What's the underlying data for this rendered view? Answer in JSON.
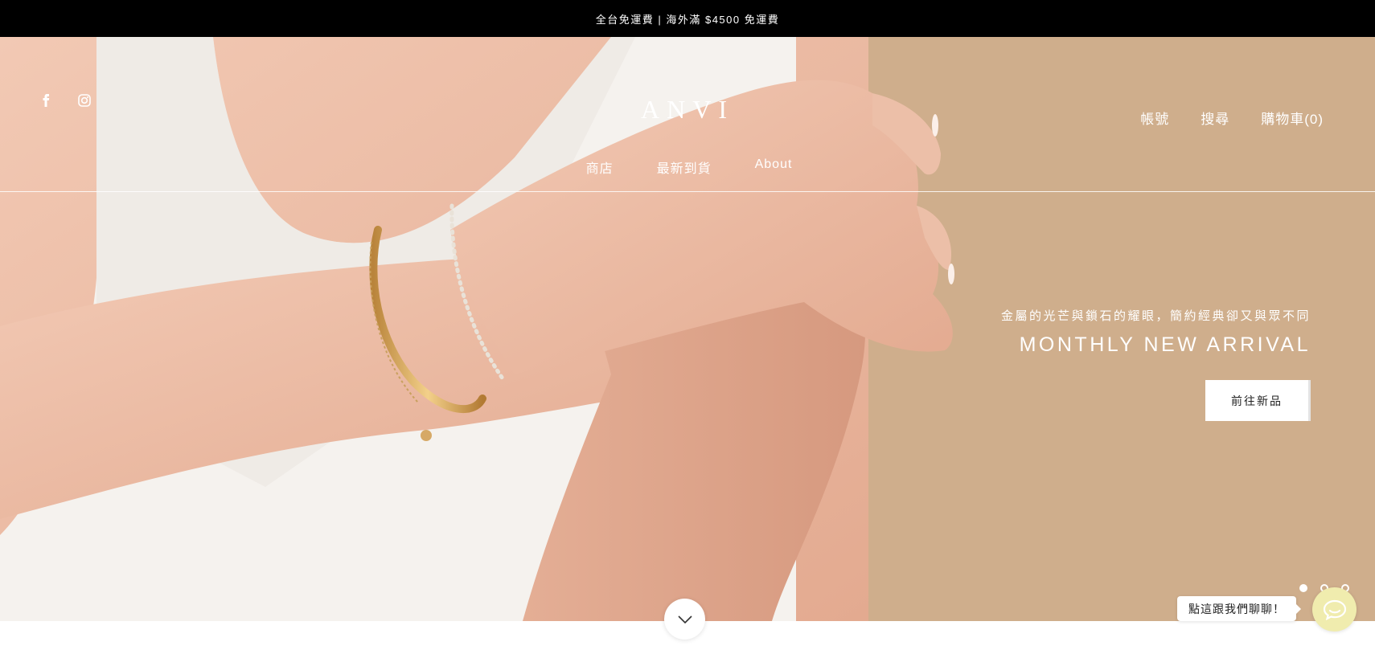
{
  "announcement": {
    "text": "全台免運費 | 海外滿 $4500 免運費"
  },
  "header": {
    "logo": "ANVI",
    "social": [
      {
        "name": "facebook-icon"
      },
      {
        "name": "instagram-icon"
      }
    ],
    "right_nav": [
      {
        "label": "帳號"
      },
      {
        "label": "搜尋"
      },
      {
        "label": "購物車(0)"
      }
    ],
    "main_nav": [
      {
        "label": "商店"
      },
      {
        "label": "最新到貨"
      },
      {
        "label": "About"
      }
    ]
  },
  "hero": {
    "subtitle": "金屬的光芒與鎖石的耀眼，簡約經典卻又與眾不同",
    "title": "MONTHLY NEW ARRIVAL",
    "cta_label": "前往新品",
    "slides_total": 3,
    "active_slide": 1,
    "background_color": "#cfae8c"
  },
  "chat": {
    "bubble_text": "點這跟我們聊聊！",
    "button_color": "#f0ecae"
  },
  "scroll_icon": "chevron-down-icon"
}
